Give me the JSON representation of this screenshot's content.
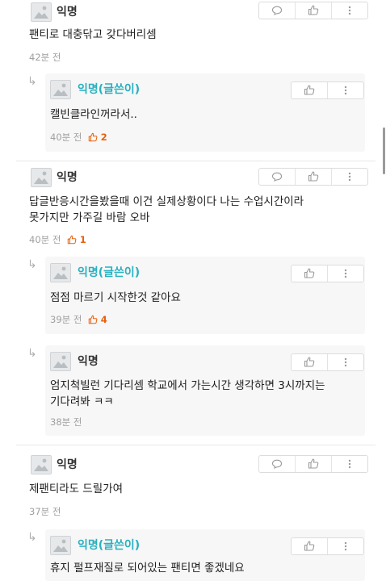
{
  "comments": [
    {
      "author": "익명",
      "text": "팬티로 대충닦고 갖다버리셈",
      "time": "42분 전",
      "likes": ""
    },
    {
      "author": "익명(글쓴이)",
      "text": "캘빈클라인꺼라서..",
      "time": "40분 전",
      "likes": "2"
    },
    {
      "author": "익명",
      "text_line1": "답글반응시간을봤을때 이건 실제상황이다 나는 수업시간이라",
      "text_line2": "못가지만 가주길 바람 오바",
      "time": "40분 전",
      "likes": "1"
    },
    {
      "author": "익명(글쓴이)",
      "text": "점점 마르기 시작한것 같아요",
      "time": "39분 전",
      "likes": "4"
    },
    {
      "author": "익명",
      "text_line1": "엄지척빌런 기다리셈 학교에서 가는시간 생각하면 3시까지는",
      "text_line2": "기다려봐 ㅋㅋ",
      "time": "38분 전",
      "likes": ""
    },
    {
      "author": "익명",
      "text": "제팬티라도 드릴가여",
      "time": "37분 전",
      "likes": ""
    },
    {
      "author": "익명(글쓴이)",
      "text": "휴지 펄프재질로 되어있는 팬티면 좋겠네요"
    }
  ],
  "icons": {
    "reply": "speech-bubble-icon",
    "like": "thumbs-up-icon",
    "more": "more-vertical-icon",
    "avatar": "anonymous-avatar-icon",
    "reply_arrow": "reply-arrow-icon"
  },
  "colors": {
    "op_name": "#29b1c0",
    "like_count": "#e8600c"
  }
}
